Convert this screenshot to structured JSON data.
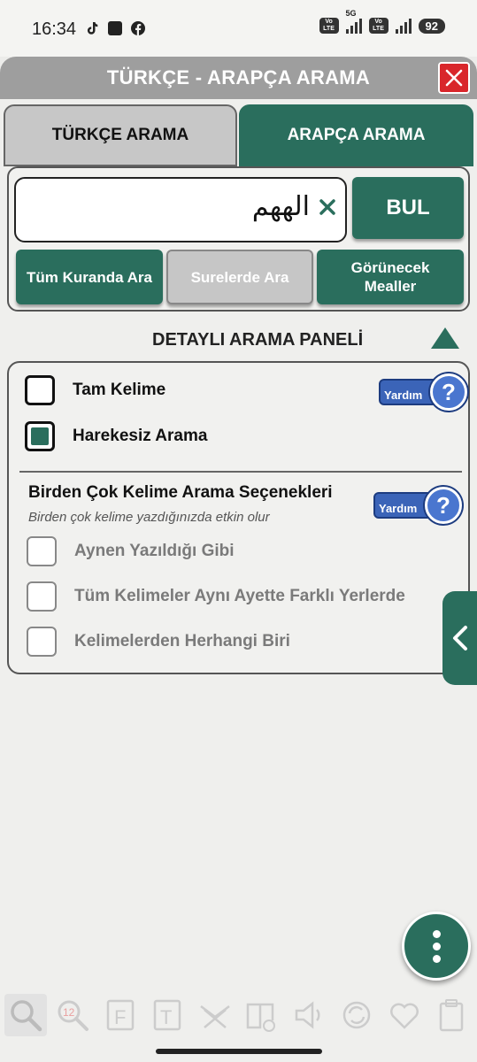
{
  "status": {
    "time": "16:34",
    "network": "5G",
    "battery": "92"
  },
  "dialog": {
    "title": "TÜRKÇE - ARAPÇA ARAMA"
  },
  "tabs": [
    {
      "label": "TÜRKÇE ARAMA",
      "active": false
    },
    {
      "label": "ARAPÇA ARAMA",
      "active": true
    }
  ],
  "search": {
    "value": "الههم",
    "button": "BUL"
  },
  "scope_buttons": [
    {
      "label": "Tüm Kuranda Ara",
      "enabled": true
    },
    {
      "label": "Surelerde Ara",
      "enabled": false
    },
    {
      "label": "Görünecek Mealler",
      "enabled": true
    }
  ],
  "detail": {
    "header": "DETAYLI ARAMA PANELİ",
    "options": [
      {
        "label": "Tam Kelime",
        "checked": false
      },
      {
        "label": "Harekesiz Arama",
        "checked": true
      }
    ],
    "help_label": "Yardım",
    "multi": {
      "title": "Birden Çok Kelime Arama Seçenekleri",
      "subtitle": "Birden çok kelime yazdığınızda etkin olur",
      "options": [
        {
          "label": "Aynen Yazıldığı Gibi",
          "checked": false
        },
        {
          "label": "Tüm Kelimeler Aynı Ayette Farklı Yerlerde",
          "checked": false
        },
        {
          "label": "Kelimelerden Herhangi Biri",
          "checked": false
        }
      ]
    }
  },
  "bottom_nav": {
    "badge_number": "12",
    "items": [
      "search-icon",
      "numbered-search-icon",
      "f-book-icon",
      "t-book-icon",
      "quran-stand-icon",
      "meal-book-icon",
      "speaker-icon",
      "sync-icon",
      "heart-icon",
      "clipboard-icon"
    ]
  },
  "colors": {
    "accent": "#2a6e5d",
    "title_bar": "#9e9e9e",
    "close": "#d9262b",
    "help": "#3b64b8"
  }
}
